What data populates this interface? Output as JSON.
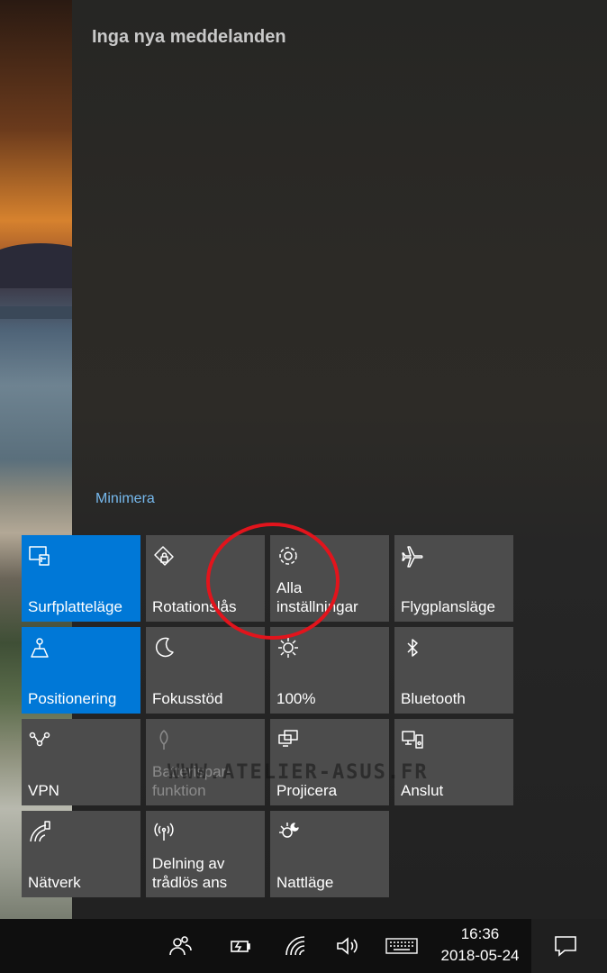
{
  "action_center": {
    "no_notifications": "Inga nya meddelanden",
    "collapse_label": "Minimera"
  },
  "quick_actions": [
    {
      "label": "Surfplatteläge",
      "icon": "tablet-mode-icon",
      "state": "on"
    },
    {
      "label": "Rotationslås",
      "icon": "rotation-lock-icon",
      "state": "off"
    },
    {
      "label": "Alla\ninställningar",
      "icon": "gear-icon",
      "state": "off"
    },
    {
      "label": "Flygplansläge",
      "icon": "airplane-icon",
      "state": "off"
    },
    {
      "label": "Positionering",
      "icon": "location-icon",
      "state": "on"
    },
    {
      "label": "Fokusstöd",
      "icon": "moon-icon",
      "state": "off"
    },
    {
      "label": "100%",
      "icon": "brightness-icon",
      "state": "off"
    },
    {
      "label": "Bluetooth",
      "icon": "bluetooth-icon",
      "state": "off"
    },
    {
      "label": "VPN",
      "icon": "vpn-icon",
      "state": "off"
    },
    {
      "label": "Batterispar-\nfunktion",
      "icon": "battery-saver-icon",
      "state": "disabled"
    },
    {
      "label": "Projicera",
      "icon": "project-icon",
      "state": "off"
    },
    {
      "label": "Anslut",
      "icon": "connect-icon",
      "state": "off"
    },
    {
      "label": "Nätverk",
      "icon": "network-icon",
      "state": "off"
    },
    {
      "label": "Delning av\ntrådlös ans",
      "icon": "mobile-hotspot-icon",
      "state": "off"
    },
    {
      "label": "Nattläge",
      "icon": "night-light-icon",
      "state": "off"
    }
  ],
  "watermark": "WWW.ATELIER-ASUS.FR",
  "taskbar": {
    "time": "16:36",
    "date": "2018-05-24",
    "tray_icons": [
      "people-icon",
      "battery-charging-icon",
      "wifi-icon",
      "volume-icon",
      "touch-keyboard-icon"
    ]
  },
  "colors": {
    "accent": "#0078d7",
    "tile_off": "#4c4c4c",
    "link": "#76b9ed",
    "annotation_circle": "#e2141c"
  }
}
